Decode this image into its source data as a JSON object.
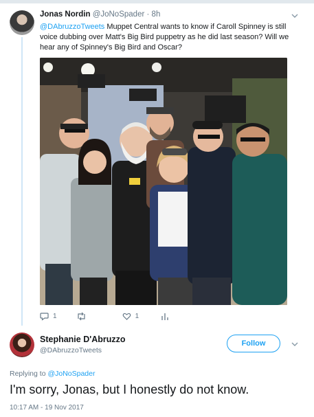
{
  "tweet1": {
    "name": "Jonas Nordin",
    "handle": "@JoNoSpader",
    "separator": "·",
    "time": "8h",
    "mention": "@DAbruzzoTweets",
    "text": "Muppet Central wants to know if Caroll Spinney is still voice dubbing over Matt's Big Bird puppetry as he did last season?  Will we hear any of Spinney's Big Bird and Oscar?",
    "photo_icon": "group-photo",
    "actions": {
      "reply_count": "1",
      "retweet_count": "",
      "like_count": "1"
    }
  },
  "tweet2": {
    "name": "Stephanie D'Abruzzo",
    "handle": "@DAbruzzoTweets",
    "follow_label": "Follow",
    "replying_prefix": "Replying to",
    "replying_to": "@JoNoSpader",
    "text": "I'm sorry, Jonas, but I honestly do not know.",
    "timestamp": "10:17 AM - 19 Nov 2017"
  },
  "colors": {
    "accent": "#1da1f2",
    "muted": "#657786",
    "text": "#14171a",
    "thread_line": "#cfe6f7"
  }
}
